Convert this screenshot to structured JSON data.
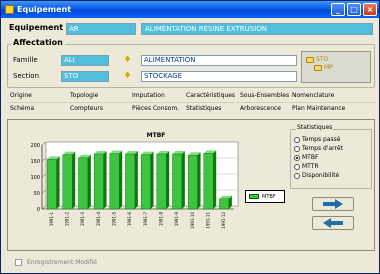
{
  "window": {
    "title": "Equipement"
  },
  "equipement": {
    "label": "Equipement",
    "code": "AR",
    "description": "ALIMENTATION RESINE EXTRUSION"
  },
  "affectation": {
    "label": "Affectation",
    "famille_label": "Famille",
    "famille_code": "ALI",
    "famille_desc": "ALIMENTATION",
    "section_label": "Section",
    "section_code": "STO",
    "section_desc": "STOCKAGE",
    "tree": [
      "STO",
      "MP"
    ]
  },
  "tabs": {
    "row1": [
      "Origine",
      "Topologie",
      "Imputation",
      "Caractéristiques",
      "Sous-Ensembles",
      "Nomenclature"
    ],
    "row2": [
      "Schéma",
      "Compteurs",
      "Pièces Consom.",
      "Statistiques",
      "Arborescence",
      "Plan Maintenance"
    ]
  },
  "stats": {
    "group_label": "Statistiques",
    "options": [
      "Temps passé",
      "Temps d'arrêt",
      "MTBF",
      "MTTR",
      "Disponibilité"
    ],
    "selected": "MTBF"
  },
  "chart_data": {
    "type": "bar",
    "title": "MTBF",
    "legend": [
      "MTBF"
    ],
    "ylim": [
      0,
      200
    ],
    "yticks": [
      "200",
      "150",
      "100",
      "50",
      "0"
    ],
    "categories": [
      "1991-1",
      "1991-2",
      "1991-3",
      "1991-4",
      "1991-5",
      "1991-6",
      "1991-7",
      "1991-8",
      "1991-9",
      "1991-10",
      "1991-11",
      "1991-12"
    ],
    "values": [
      155,
      170,
      160,
      172,
      173,
      172,
      170,
      172,
      172,
      168,
      174,
      32
    ]
  },
  "status": {
    "label": "Enregistrement Modifié"
  },
  "colors": {
    "bar": "#3ec43e",
    "field": "#4fbfdb",
    "title": "#0a5be3"
  }
}
